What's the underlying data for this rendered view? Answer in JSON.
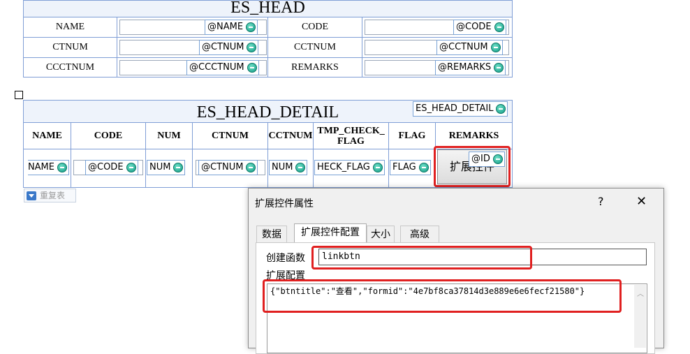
{
  "es_head": {
    "title": "ES_HEAD",
    "rows": [
      {
        "l1": "NAME",
        "t1": "@NAME",
        "l2": "CODE",
        "t2": "@CODE"
      },
      {
        "l1": "CTNUM",
        "t1": "@CTNUM",
        "l2": "CCTNUM",
        "t2": "@CCTNUM"
      },
      {
        "l1": "CCCTNUM",
        "t1": "@CCCTNUM",
        "l2": "REMARKS",
        "t2": "@REMARKS"
      }
    ]
  },
  "detail": {
    "title": "ES_HEAD_DETAIL",
    "tag": "ES_HEAD_DETAIL",
    "headers": [
      "NAME",
      "CODE",
      "NUM",
      "CTNUM",
      "CCTNUM",
      "TMP_CHECK_\nFLAG",
      "FLAG",
      "REMARKS"
    ],
    "cells": [
      "NAME",
      "@CODE",
      "NUM",
      "@CTNUM",
      "NUM",
      "HECK_FLAG",
      "FLAG"
    ],
    "ext_button_label": "扩展控件",
    "id_tag": "@ID",
    "repeat_label": "重复表"
  },
  "dialog": {
    "title": "扩展控件属性",
    "help_label": "?",
    "close_label": "✕",
    "tabs": [
      "数据",
      "扩展控件配置",
      "大小",
      "高级"
    ],
    "active_tab": 1,
    "create_fn_label": "创建函数",
    "create_fn_value": "linkbtn",
    "ext_config_label": "扩展配置",
    "ext_config_value": "{\"btntitle\":\"查看\",\"formid\":\"4e7bf8ca37814d3e889e6e6fecf21580\"}"
  },
  "colors": {
    "border": "#7f9ed6",
    "highlight": "#e02020",
    "title_bg": "#eef3fb"
  }
}
